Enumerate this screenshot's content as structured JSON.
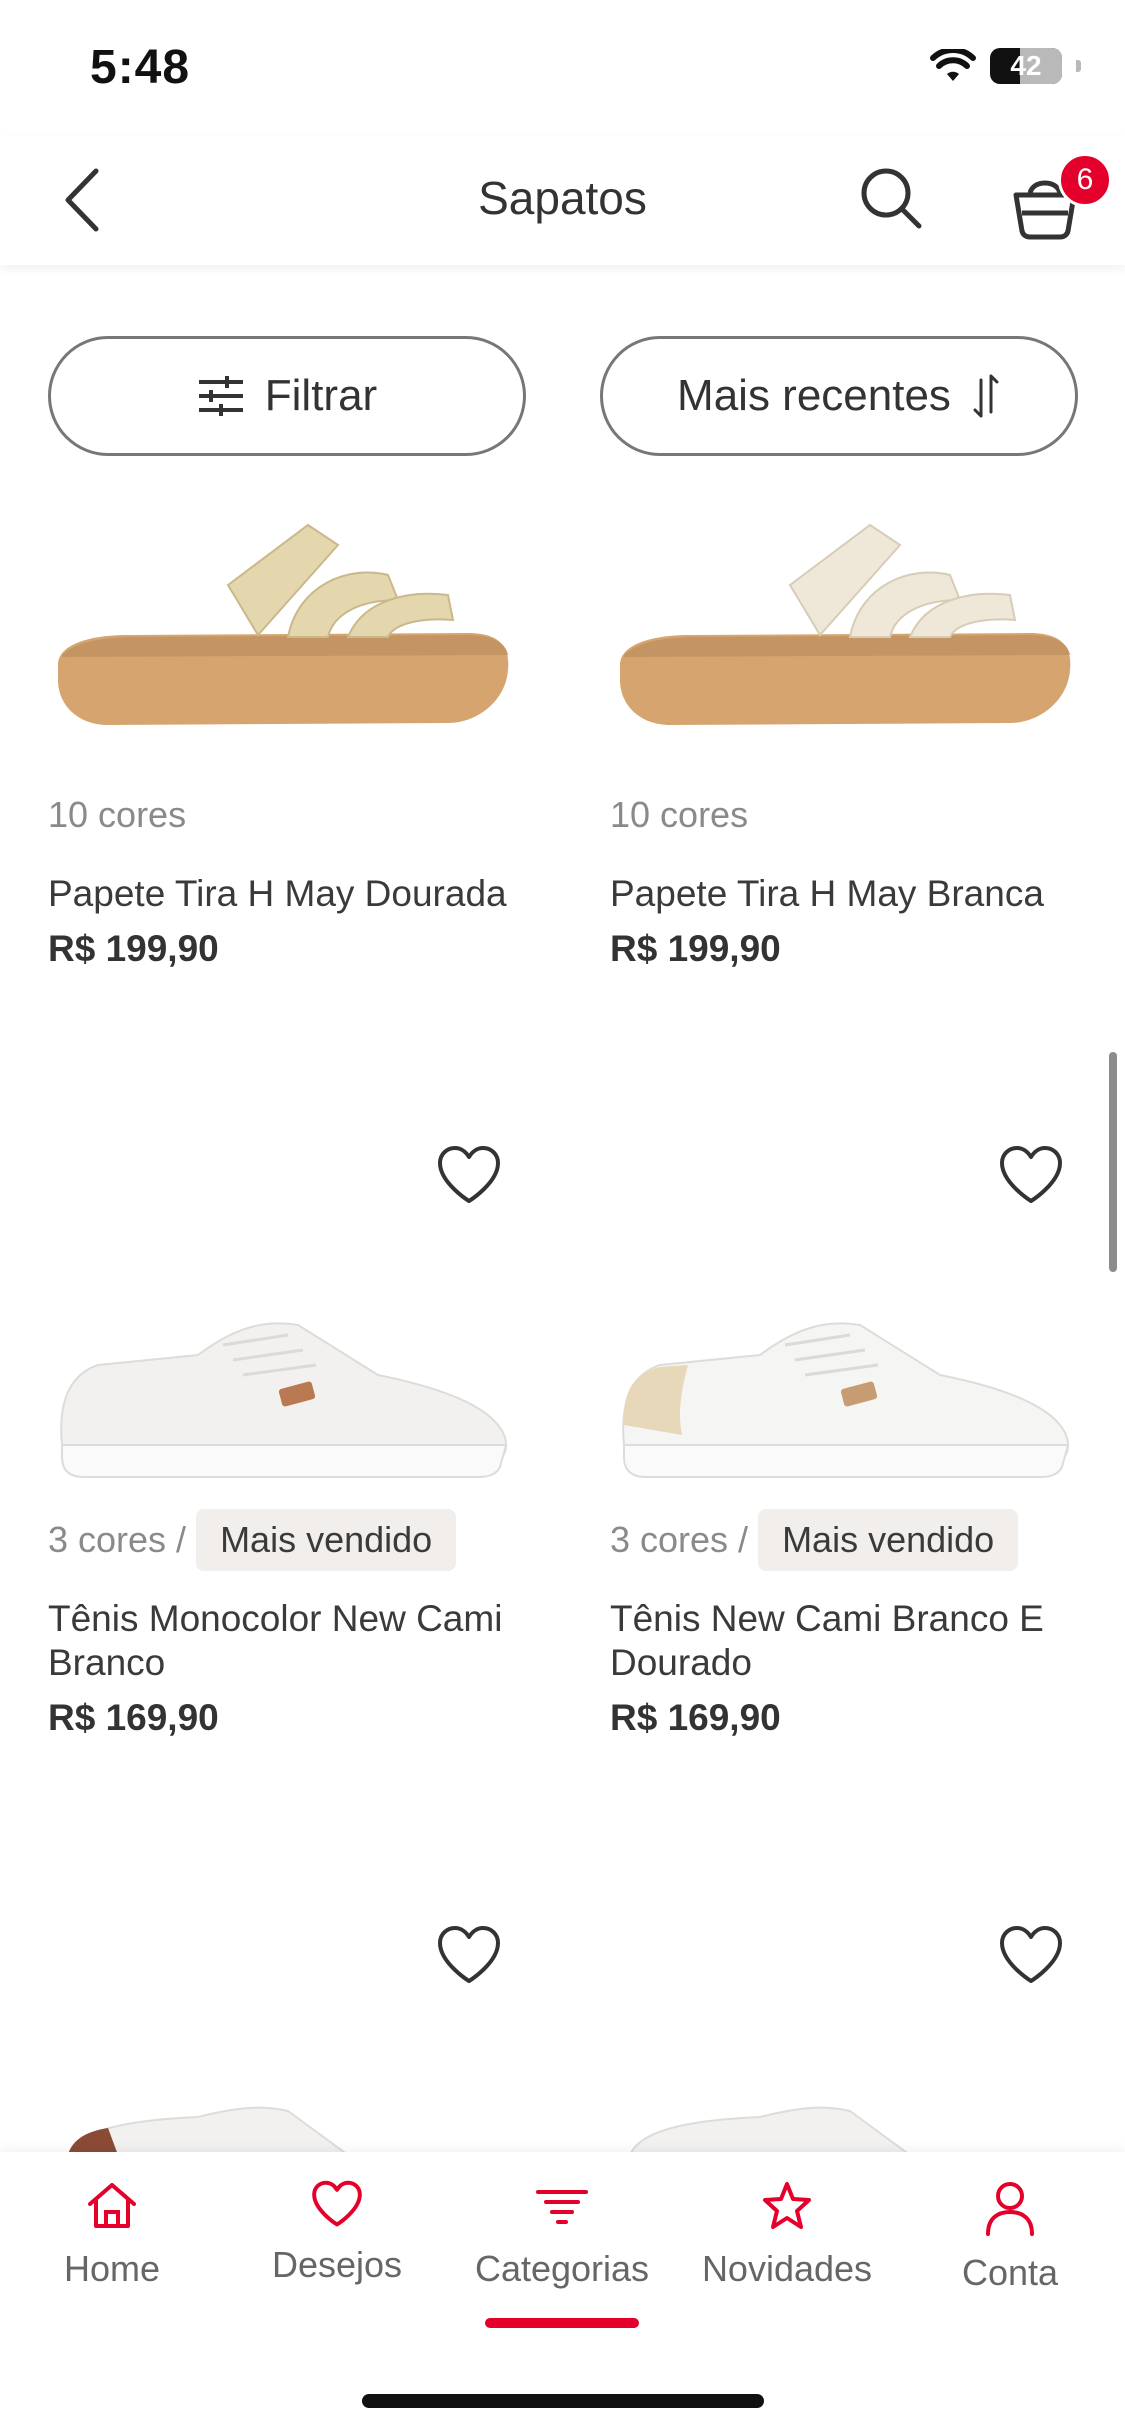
{
  "status": {
    "time": "5:48",
    "battery": "42"
  },
  "header": {
    "title": "Sapatos",
    "cart_count": "6"
  },
  "filters": {
    "filter_label": "Filtrar",
    "sort_label": "Mais recentes"
  },
  "products": [
    {
      "colors": "10 cores",
      "badge": "",
      "name": "Papete Tira H May Dourada",
      "price": "R$ 199,90",
      "strap_color": "#e4d7ad"
    },
    {
      "colors": "10 cores",
      "badge": "",
      "name": "Papete Tira H May Branca",
      "price": "R$ 199,90",
      "strap_color": "#efe8d8"
    },
    {
      "colors": "3 cores /",
      "badge": "Mais vendido",
      "name": "Tênis Monocolor New Cami Branco",
      "price": "R$ 169,90"
    },
    {
      "colors": "3 cores /",
      "badge": "Mais vendido",
      "name": "Tênis New Cami Branco E Dourado",
      "price": "R$ 169,90"
    }
  ],
  "nav": {
    "items": [
      {
        "label": "Home",
        "icon": "home-icon"
      },
      {
        "label": "Desejos",
        "icon": "heart-icon"
      },
      {
        "label": "Categorias",
        "icon": "categories-icon"
      },
      {
        "label": "Novidades",
        "icon": "star-icon"
      },
      {
        "label": "Conta",
        "icon": "user-icon"
      }
    ],
    "active": "Categorias"
  },
  "colors": {
    "accent": "#e4002b",
    "text": "#3a3a3a",
    "muted": "#8a8a8a",
    "sole": "#d6a56f"
  }
}
